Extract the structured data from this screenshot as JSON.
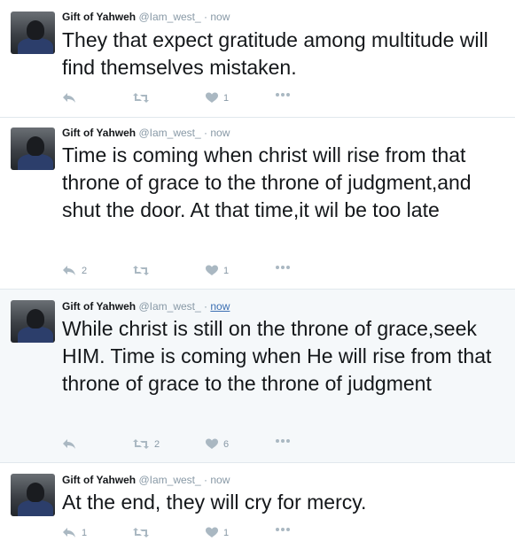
{
  "tweets": [
    {
      "name": "Gift of Yahweh",
      "handle": "@Iam_west_",
      "sep": "·",
      "time": "now",
      "text": "They that expect gratitude among multitude will find themselves mistaken.",
      "reply_count": "",
      "retweet_count": "",
      "like_count": "1"
    },
    {
      "name": "Gift of Yahweh",
      "handle": "@Iam_west_",
      "sep": "·",
      "time": "now",
      "text": "Time is coming when christ will rise from that throne of grace to the throne of judgment,and shut the door. At that time,it wil be too late",
      "reply_count": "2",
      "retweet_count": "",
      "like_count": "1"
    },
    {
      "name": "Gift of Yahweh",
      "handle": "@Iam_west_",
      "sep": "·",
      "time": "now",
      "text": "While christ is still on the throne of grace,seek HIM. Time is coming when He will rise from that throne of grace to the throne of judgment",
      "reply_count": "",
      "retweet_count": "2",
      "like_count": "6"
    },
    {
      "name": "Gift of Yahweh",
      "handle": "@Iam_west_",
      "sep": "·",
      "time": "now",
      "text": "At the end, they will cry for mercy.",
      "reply_count": "1",
      "retweet_count": "",
      "like_count": "1"
    }
  ],
  "icons": {
    "reply": "reply-icon",
    "retweet": "retweet-icon",
    "like": "heart-icon",
    "more": "more-icon"
  },
  "colors": {
    "icon": "#aab8c2",
    "highlight_bg": "#f5f8fa",
    "link": "#3b6fb2",
    "border": "#e1e8ed"
  }
}
